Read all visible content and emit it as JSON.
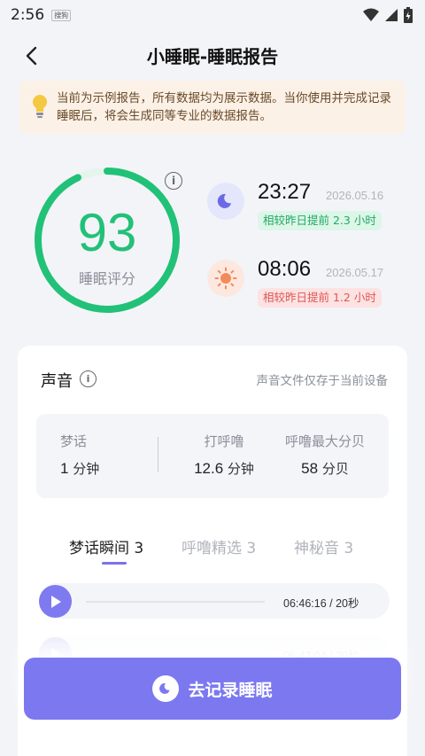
{
  "statusbar": {
    "time": "2:56",
    "carrier": "搜狗"
  },
  "header": {
    "title": "小睡眠-睡眠报告"
  },
  "notice": {
    "text": "当前为示例报告，所有数据均为展示数据。当你使用并完成记录睡眠后，将会生成同等专业的数据报告。"
  },
  "score": {
    "value": "93",
    "label": "睡眠评分",
    "ring_fraction": 0.93,
    "ring_color": "#22c178"
  },
  "sleep": {
    "time": "23:27",
    "date": "2026.05.16",
    "compare": "相较昨日提前 2.3 小时"
  },
  "wake": {
    "time": "08:06",
    "date": "2026.05.17",
    "compare": "相较昨日提前 1.2 小时"
  },
  "sound": {
    "title": "声音",
    "note": "声音文件仅存于当前设备",
    "stats": [
      {
        "label": "梦话",
        "value": "1",
        "unit": "分钟"
      },
      {
        "label": "打呼噜",
        "value": "12.6",
        "unit": "分钟"
      },
      {
        "label": "呼噜最大分贝",
        "value": "58",
        "unit": "分贝"
      }
    ],
    "tabs": [
      "梦话瞬间 3",
      "呼噜精选 3",
      "神秘音 3"
    ],
    "tracks": [
      {
        "info": "06:46:16  /  20秒"
      },
      {
        "info": "06:42:04  /  20秒"
      }
    ]
  },
  "cta": {
    "label": "去记录睡眠"
  },
  "colors": {
    "accent": "#7c78f0",
    "green": "#22c178",
    "red": "#e05555"
  }
}
